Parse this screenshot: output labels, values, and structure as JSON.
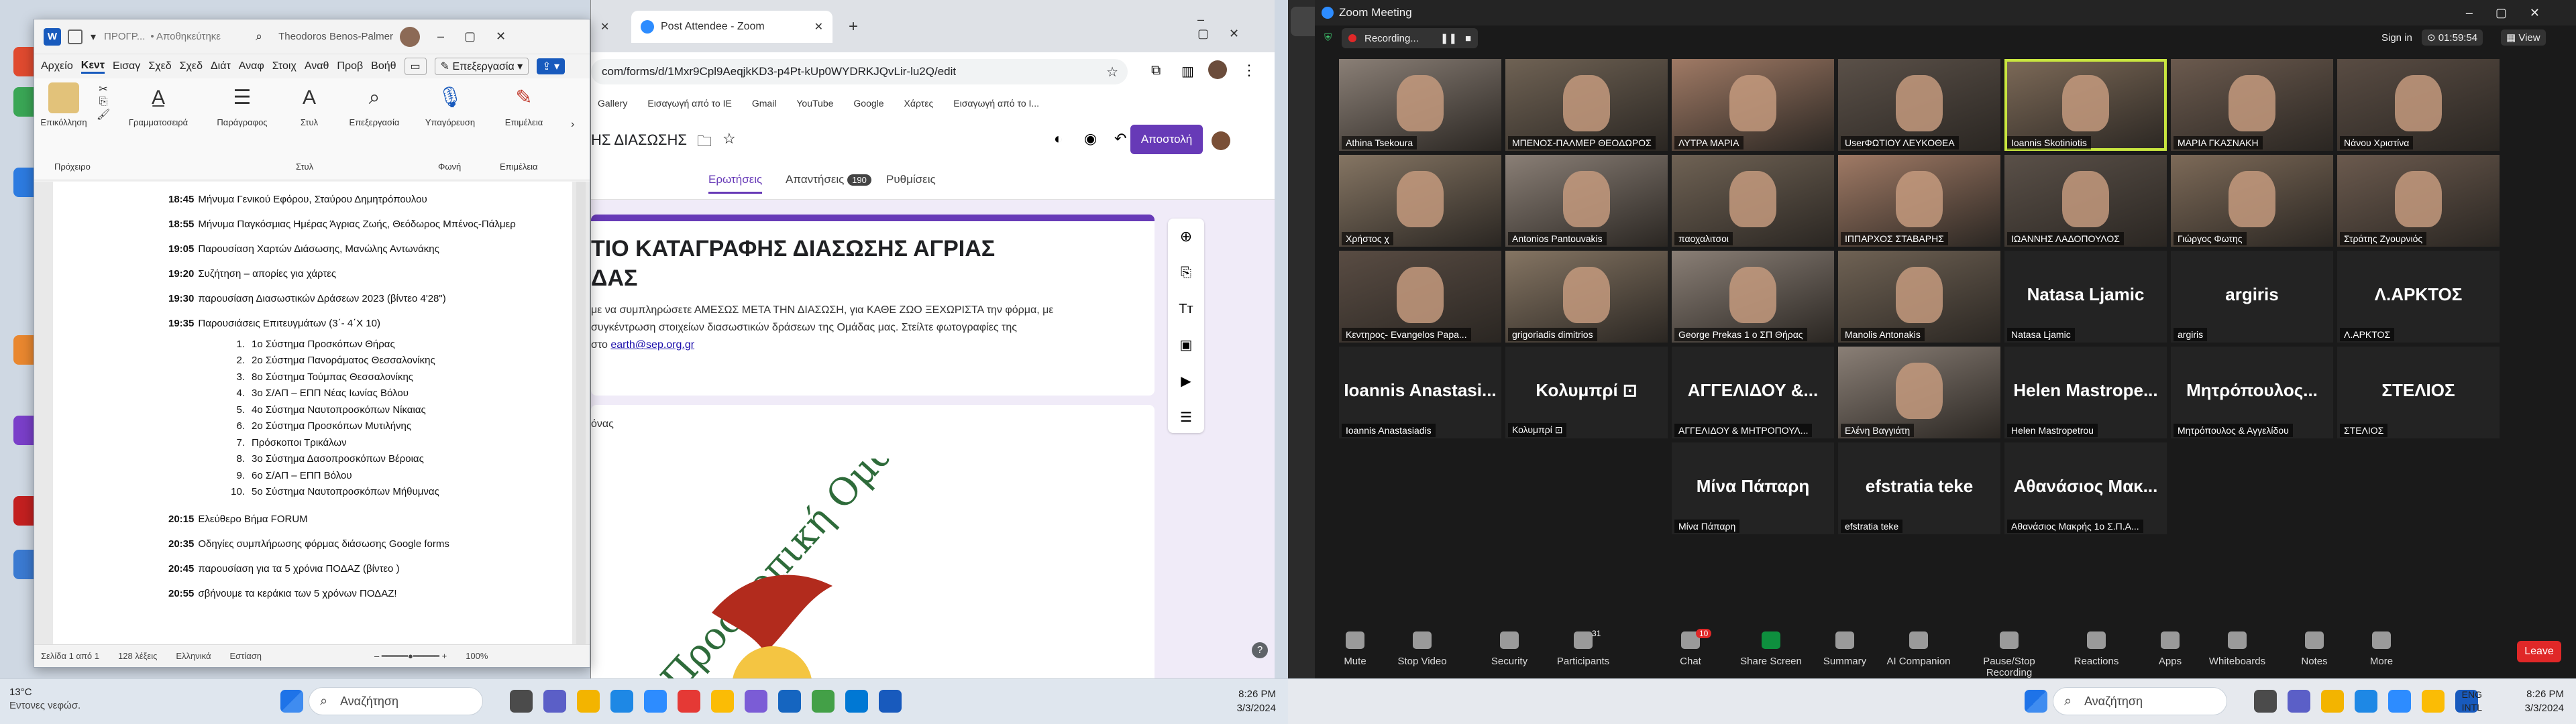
{
  "word": {
    "title_doc": "ΠΡΟΓΡ...",
    "title_save": "• Αποθηκεύτηκε",
    "user": "Theodoros Benos-Palmer",
    "menu": [
      "Αρχείο",
      "Κεντ",
      "Εισαγ",
      "Σχεδ",
      "Σχεδ",
      "Διάτ",
      "Αναφ",
      "Στοιχ",
      "Αναθ",
      "Προβ",
      "Βοήθ"
    ],
    "editing_mode": "Επεξεργασία",
    "ribbon": {
      "paste": "Επικόλληση",
      "clipboard": "Πρόχειρο",
      "font": "Γραμματοσειρά",
      "paragraph": "Παράγραφος",
      "styles": "Στυλ",
      "styles_group": "Στυλ",
      "editing": "Επεξεργασία",
      "dictate": "Υπαγόρευση",
      "voice": "Φωνή",
      "addins": "Επιμέλεια",
      "addins_group": "Επιμέλεια"
    },
    "agenda": [
      {
        "time": "18:45",
        "text": "Μήνυμα Γενικού Εφόρου, Σταύρου Δημητρόπουλου"
      },
      {
        "time": "18:55",
        "text": "Μήνυμα Παγκόσμιας Ημέρας Άγριας Ζωής, Θεόδωρος Μπένος-Πάλμερ"
      },
      {
        "time": "19:05",
        "text": "Παρουσίαση Χαρτών Διάσωσης, Μανώλης Αντωνάκης"
      },
      {
        "time": "19:20",
        "text": "Συζήτηση – απορίες για χάρτες"
      },
      {
        "time": "19:30",
        "text": "παρουσίαση Διασωστικών Δράσεων 2023 (βίντεο 4'28\")"
      },
      {
        "time": "19:35",
        "text": "Παρουσιάσεις Επιτευγμάτων (3΄- 4΄Χ 10)"
      }
    ],
    "systems": [
      "1ο Σύστημα Προσκόπων Θήρας",
      "2ο Σύστημα Πανοράματος Θεσσαλονίκης",
      "8ο Σύστημα Τούμπας Θεσσαλονίκης",
      "3ο Σ/ΑΠ – ΕΠΠ Νέας Ιωνίας Βόλου",
      "4ο Σύστημα Ναυτοπροσκόπων Νίκαιας",
      "2ο Σύστημα Προσκόπων Μυτιλήνης",
      "Πρόσκοποι Τρικάλων",
      "3ο Σύστημα Δασοπροσκόπων Βέροιας",
      "6ο Σ/ΑΠ – ΕΠΠ Βόλου",
      "5ο Σύστημα Ναυτοπροσκόπων Μήθυμνας"
    ],
    "agenda2": [
      {
        "time": "20:15",
        "text": "Ελεύθερο Βήμα FORUM"
      },
      {
        "time": "20:35",
        "text": "Οδηγίες συμπλήρωσης φόρμας διάσωσης Google forms"
      },
      {
        "time": "20:45",
        "text": "παρουσίαση για τα 5 χρόνια ΠΟΔΑΖ (βίντεο     )"
      },
      {
        "time": "20:55",
        "text": "σβήνουμε τα κεράκια των 5 χρόνων ΠΟΔΑΖ!"
      }
    ],
    "status": {
      "page": "Σελίδα 1 από 1",
      "words": "128 λέξεις",
      "lang": "Ελληνικά",
      "focus": "Εστίαση",
      "zoom": "100%"
    }
  },
  "chrome": {
    "tabs": [
      {
        "label": "Post Attendee - Zoom"
      }
    ],
    "url": "com/forms/d/1Mxr9Cpl9AeqjkKD3-p4Pt-kUp0WYDRKJQvLir-lu2Q/edit",
    "bookmarks": [
      "Gallery",
      "Εισαγωγή από το IE",
      "Gmail",
      "YouTube",
      "Google",
      "Χάρτες",
      "Εισαγωγή από το I..."
    ],
    "form_title_short": "ΗΣ ΔΙΑΣΩΣΗΣ",
    "send": "Αποστολή",
    "form_tabs": [
      "Ερωτήσεις",
      "Απαντήσεις",
      "Ρυθμίσεις"
    ],
    "responses_count": "190",
    "form_heading_1": "ΤΙΟ ΚΑΤΑΓΡΑΦΗΣ ΔΙΑΣΩΣΗΣ ΑΓΡΙΑΣ",
    "form_heading_2": "ΔΑΣ",
    "form_desc_1": "με να συμπληρώσετε ΑΜΕΣΩΣ ΜΕΤΑ ΤΗΝ ΔΙΑΣΩΣΗ, για ΚΑΘΕ ΖΩΟ ΞΕΧΩΡΙΣΤΑ την φόρμα, με",
    "form_desc_2": "συγκέντρωση στοιχείων διασωστικών δράσεων της Ομάδας μας. Στείλτε φωτογραφίες της",
    "form_desc_3": "στο",
    "form_email": "earth@sep.org.gr",
    "form_q": "όνας",
    "logo_text": "Προσκοπική Ομάδα Διάσωσης Άγρι"
  },
  "zoom": {
    "title": "Zoom Meeting",
    "recording": "Recording...",
    "signin": "Sign in",
    "timer": "01:59:54",
    "view": "View",
    "tiles": [
      {
        "label": "Athina Tsekoura",
        "video": true
      },
      {
        "label": "ΜΠΕΝΟΣ-ΠΑΛΜΕΡ ΘΕΟΔΩΡΟΣ",
        "video": true
      },
      {
        "label": "ΛΥΤΡΑ ΜΑΡΙΑ",
        "video": true
      },
      {
        "label": "UserΦΩΤΙΟΥ ΛΕΥΚΟΘΕΑ",
        "video": true
      },
      {
        "label": "Ioannis Skotiniotis",
        "video": true,
        "speaker": true
      },
      {
        "label": "ΜΑΡΙΑ ΓΚΑΣΝΑΚΗ",
        "video": true
      },
      {
        "label": "Νάνου Χριστίνα",
        "video": true
      },
      {
        "label": "Χρήστος χ",
        "video": true
      },
      {
        "label": "Antonios Pantouvakis",
        "video": true
      },
      {
        "label": "παοχαλιτσοι",
        "video": true
      },
      {
        "label": "ΙΠΠΑΡΧΟΣ ΣΤΑΒΑΡΗΣ",
        "video": true
      },
      {
        "label": "ΙΩΑΝΝΗΣ ΛΑΔΟΠΟΥΛΟΣ",
        "video": true
      },
      {
        "label": "Γιώργος Φωτης",
        "video": true
      },
      {
        "label": "Στράτης Ζγουρνιός",
        "video": true
      },
      {
        "label": "Κεντηρος- Evangelos Papa...",
        "video": true
      },
      {
        "label": "grigoriadis dimitrios",
        "video": true
      },
      {
        "label": "George Prekas 1 ο ΣΠ Θήρας",
        "video": true
      },
      {
        "label": "Manolis Antonakis",
        "video": true
      },
      {
        "label": "Natasa Ljamic",
        "big": "Natasa Ljamic"
      },
      {
        "label": "argiris",
        "big": "argiris"
      },
      {
        "label": "Λ.ΑΡΚΤΟΣ",
        "big": "Λ.ΑΡΚΤΟΣ"
      },
      {
        "label": "Ioannis Anastasiadis",
        "big": "Ioannis Anastasi..."
      },
      {
        "label": "Κολυμπρί ⊡",
        "big": "Κολυμπρί ⊡"
      },
      {
        "label": "ΑΓΓΕΛΙΔΟΥ & ΜΗΤΡΟΠΟΥΛ...",
        "big": "ΑΓΓΕΛΙΔΟΥ &..."
      },
      {
        "label": "Ελένη Βαγγιάτη",
        "video": true
      },
      {
        "label": "Helen Mastropetrou",
        "big": "Helen Mastrope..."
      },
      {
        "label": "Μητρόπουλος & Αγγελίδου",
        "big": "Μητρόπουλος..."
      },
      {
        "label": "ΣΤΕΛΙΟΣ",
        "big": "ΣΤΕΛΙΟΣ"
      },
      {
        "label": "Μίνα Πάπαρη",
        "big": "Μίνα Πάπαρη"
      },
      {
        "label": "efstratia teke",
        "big": "efstratia teke"
      },
      {
        "label": "Αθανάσιος Μακρής 1ο Σ.Π.Α...",
        "big": "Αθανάσιος Μακ..."
      }
    ],
    "toolbar": [
      {
        "label": "Mute",
        "icon": "microphone-icon"
      },
      {
        "label": "Stop Video",
        "icon": "video-camera-icon"
      },
      {
        "label": "Security",
        "icon": "shield-icon"
      },
      {
        "label": "Participants",
        "icon": "participants-icon",
        "badge": "31"
      },
      {
        "label": "Chat",
        "icon": "chat-icon",
        "badge": "10"
      },
      {
        "label": "Share Screen",
        "icon": "share-screen-icon"
      },
      {
        "label": "Summary",
        "icon": "summary-icon"
      },
      {
        "label": "AI Companion",
        "icon": "ai-companion-icon"
      },
      {
        "label": "Pause/Stop Recording",
        "icon": "record-icon"
      },
      {
        "label": "Reactions",
        "icon": "reactions-icon"
      },
      {
        "label": "Apps",
        "icon": "apps-icon"
      },
      {
        "label": "Whiteboards",
        "icon": "whiteboard-icon"
      },
      {
        "label": "Notes",
        "icon": "notes-icon"
      },
      {
        "label": "More",
        "icon": "more-icon"
      }
    ],
    "leave": "Leave"
  },
  "taskbar1": {
    "weather_temp": "13°C",
    "weather_text": "Εντονες νεφώσ.",
    "search": "Αναζήτηση",
    "time": "8:26 PM",
    "date": "3/3/2024"
  },
  "taskbar2": {
    "search": "Αναζήτηση",
    "lang1": "ENG",
    "lang2": "INTL",
    "time": "8:26 PM",
    "date": "3/3/2024"
  },
  "colors": {
    "word_blue": "#185abd",
    "forms_purple": "#673ab7",
    "zoom_green": "#0e8f3e",
    "zoom_red": "#e02828",
    "speaker_outline": "#c9e63f"
  }
}
